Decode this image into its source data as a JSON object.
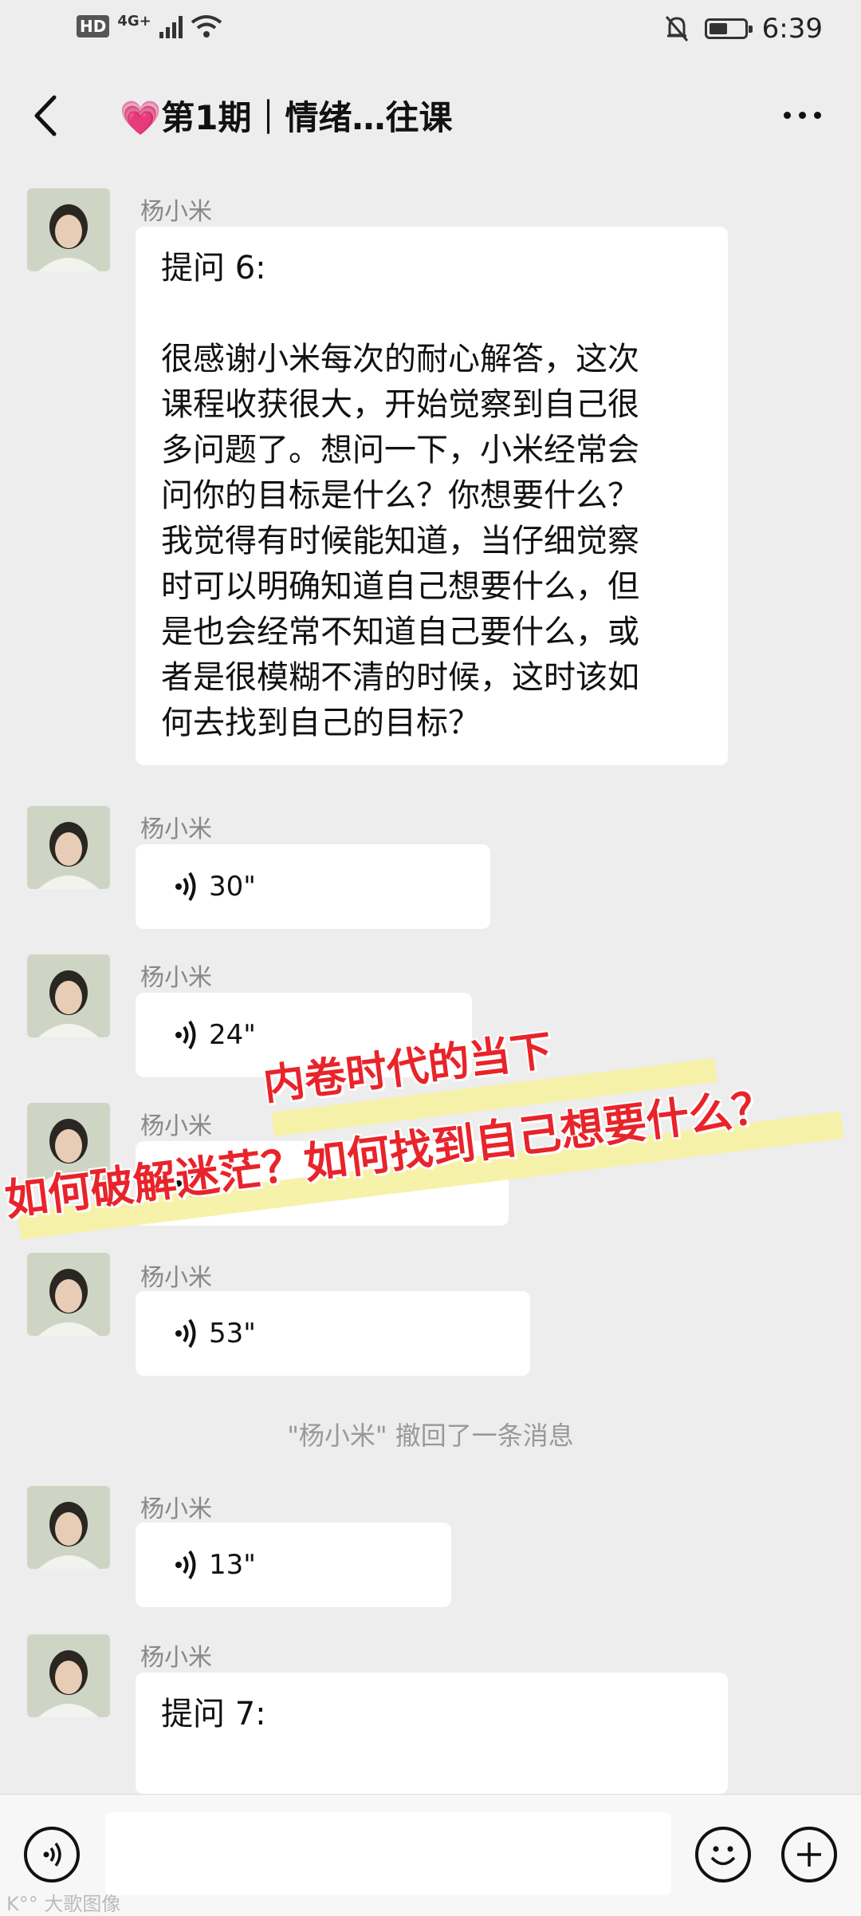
{
  "status_bar": {
    "hd": "HD",
    "network": "4G+",
    "time": "6:39",
    "icons": [
      "signal-icon",
      "wifi-icon",
      "mute-icon",
      "battery-icon"
    ]
  },
  "header": {
    "title": "💗第1期｜情绪…往课",
    "back_icon": "back-chevron-icon",
    "more_icon": "more-dots-icon"
  },
  "messages": [
    {
      "sender": "杨小米",
      "type": "text",
      "lines": [
        "提问 6:",
        "",
        "很感谢小米每次的耐心解答，这次",
        "课程收获很大，开始觉察到自己很",
        "多问题了。想问一下，小米经常会",
        "问你的目标是什么？你想要什么？",
        "我觉得有时候能知道，当仔细觉察",
        "时可以明确知道自己想要什么，但",
        "是也会经常不知道自己要什么，或",
        "者是很模糊不清的时候，这时该如",
        "何去找到自己的目标？"
      ]
    },
    {
      "sender": "杨小米",
      "type": "voice",
      "duration": "30\""
    },
    {
      "sender": "杨小米",
      "type": "voice",
      "duration": "24\""
    },
    {
      "sender": "杨小米",
      "type": "voice",
      "duration": ""
    },
    {
      "sender": "杨小米",
      "type": "voice",
      "duration": "53\""
    },
    {
      "type": "system",
      "text": "\"杨小米\" 撤回了一条消息"
    },
    {
      "sender": "杨小米",
      "type": "voice",
      "duration": "13\""
    },
    {
      "sender": "杨小米",
      "type": "text",
      "lines": [
        "提问 7:"
      ]
    }
  ],
  "overlay": {
    "line1": "内卷时代的当下",
    "line2": "如何破解迷茫？如何找到自己想要什么？"
  },
  "input_bar": {
    "voice_icon": "voice-toggle-icon",
    "emoji_icon": "emoji-icon",
    "plus_icon": "plus-icon"
  },
  "watermark": "K°° 大歌图像",
  "colors": {
    "banner_red": "#e8242a",
    "highlight": "#f6f1a0",
    "bg": "#ededed"
  }
}
